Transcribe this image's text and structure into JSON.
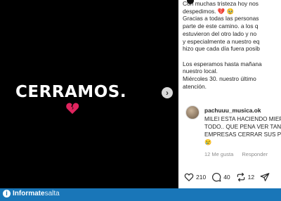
{
  "post": {
    "headline": "CERRAMOS.",
    "caption_lines": [
      "Con muchas tristeza hoy nos",
      "despedimos. 💔 🥹",
      "Gracias a todas las personas",
      "parte de este camino. a los q",
      "estuvieron del otro lado y no",
      "y especialmente a nuestro eq",
      "hizo que cada día fuera posib",
      "",
      "Los esperamos hasta mañana",
      "nuestro local.",
      "Miércoles 30. nuestro último",
      "atención."
    ]
  },
  "comment": {
    "username": "pachuuu_musica.ok",
    "lines": [
      "MILEI ESTA HACIENDO MIER",
      "TODO.. QUE PENA VER TANT",
      "EMPRESAS CERRAR SUS PUE",
      "😢"
    ],
    "likes_label": "12 Me gusta",
    "reply_label": "Responder"
  },
  "actions": {
    "likes": "210",
    "comments": "40",
    "reposts": "12"
  },
  "footer": {
    "brand_bold": "Informate",
    "brand_light": "salta"
  },
  "colors": {
    "footer_bg": "#1976b8",
    "heart_red": "#e0245e"
  }
}
